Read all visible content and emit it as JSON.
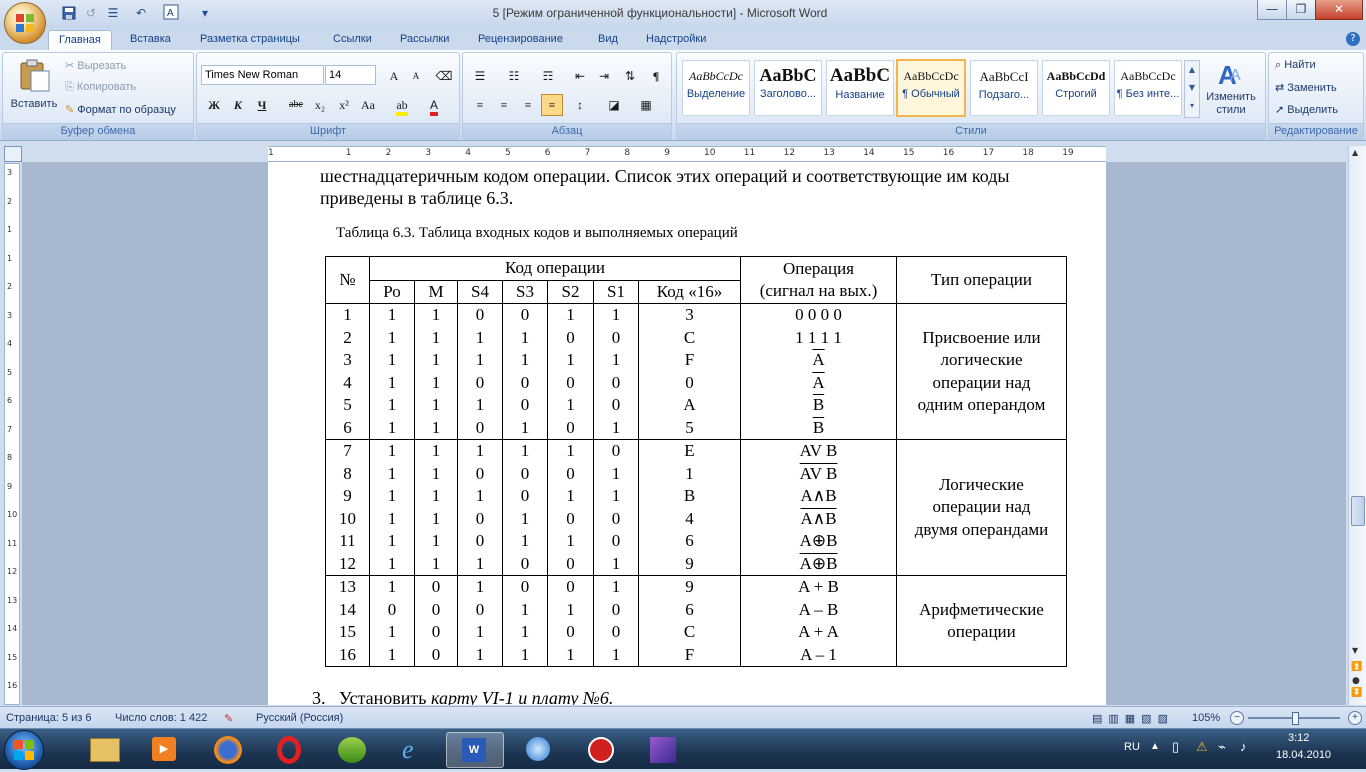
{
  "window": {
    "title": "5 [Режим ограниченной функциональности] - Microsoft Word",
    "controls": [
      "—",
      "❐",
      "✕"
    ]
  },
  "tabs": [
    {
      "label": "Главная",
      "active": true
    },
    {
      "label": "Вставка"
    },
    {
      "label": "Разметка страницы"
    },
    {
      "label": "Ссылки"
    },
    {
      "label": "Рассылки"
    },
    {
      "label": "Рецензирование"
    },
    {
      "label": "Вид"
    },
    {
      "label": "Надстройки"
    }
  ],
  "clipboard": {
    "group_label": "Буфер обмена",
    "paste": "Вставить",
    "cut": "Вырезать",
    "copy": "Копировать",
    "format_painter": "Формат по образцу"
  },
  "font": {
    "group_label": "Шрифт",
    "name": "Times New Roman",
    "size": "14",
    "bold": "Ж",
    "italic": "К",
    "underline": "Ч",
    "strike": "abe",
    "sub": "x₂",
    "sup": "x²",
    "case": "Aa",
    "grow": "A",
    "shrink": "A"
  },
  "paragraph": {
    "group_label": "Абзац"
  },
  "styles": {
    "group_label": "Стили",
    "items": [
      {
        "sample": "AaBbCcDc",
        "name": "Выделение"
      },
      {
        "sample": "AaBbC",
        "name": "Заголово..."
      },
      {
        "sample": "AaBbC",
        "name": "Название"
      },
      {
        "sample": "AaBbCcDc",
        "name": "¶ Обычный",
        "selected": true
      },
      {
        "sample": "AaBbCcI",
        "name": "Подзаго..."
      },
      {
        "sample": "AaBbCcDd",
        "name": "Строгий"
      },
      {
        "sample": "AaBbCcDc",
        "name": "¶ Без инте..."
      }
    ],
    "change_styles": "Изменить стили"
  },
  "editing": {
    "group_label": "Редактирование",
    "find": "Найти",
    "replace": "Заменить",
    "select": "Выделить"
  },
  "ruler": {
    "h_numbers": [
      "1",
      "1",
      "2",
      "3",
      "4",
      "5",
      "6",
      "7",
      "8",
      "9",
      "10",
      "11",
      "12",
      "13",
      "14",
      "15",
      "16",
      "17",
      "18",
      "19"
    ],
    "v_numbers": [
      "3",
      "2",
      "1",
      "1",
      "2",
      "3",
      "4",
      "5",
      "6",
      "7",
      "8",
      "9",
      "10",
      "11",
      "12",
      "13",
      "14",
      "15",
      "16"
    ]
  },
  "document": {
    "para1_line1": "шестнадцатеричным кодом операции. Список этих операций и соответствующие им коды",
    "para1_line2": "приведены в таблице 6.3.",
    "caption": "Таблица 6.3. Таблица входных кодов и выполняемых операций",
    "table": {
      "h_num": "№",
      "h_code": "Код операции",
      "h_op_line1": "Операция",
      "h_op_line2": "(сигнал на вых.)",
      "h_type": "Тип операции",
      "sub": [
        "Ро",
        "М",
        "S4",
        "S3",
        "S2",
        "S1",
        "Код «16»"
      ],
      "rows": [
        [
          "1",
          "1",
          "1",
          "0",
          "0",
          "1",
          "1",
          "3"
        ],
        [
          "2",
          "1",
          "1",
          "1",
          "1",
          "0",
          "0",
          "C"
        ],
        [
          "3",
          "1",
          "1",
          "1",
          "1",
          "1",
          "1",
          "F"
        ],
        [
          "4",
          "1",
          "1",
          "0",
          "0",
          "0",
          "0",
          "0"
        ],
        [
          "5",
          "1",
          "1",
          "1",
          "0",
          "1",
          "0",
          "A"
        ],
        [
          "6",
          "1",
          "1",
          "0",
          "1",
          "0",
          "1",
          "5"
        ],
        [
          "7",
          "1",
          "1",
          "1",
          "1",
          "1",
          "0",
          "E"
        ],
        [
          "8",
          "1",
          "1",
          "0",
          "0",
          "0",
          "1",
          "1"
        ],
        [
          "9",
          "1",
          "1",
          "1",
          "0",
          "1",
          "1",
          "B"
        ],
        [
          "10",
          "1",
          "1",
          "0",
          "1",
          "0",
          "0",
          "4"
        ],
        [
          "11",
          "1",
          "1",
          "0",
          "1",
          "1",
          "0",
          "6"
        ],
        [
          "12",
          "1",
          "1",
          "1",
          "0",
          "0",
          "1",
          "9"
        ],
        [
          "13",
          "1",
          "0",
          "1",
          "0",
          "0",
          "1",
          "9"
        ],
        [
          "14",
          "0",
          "0",
          "0",
          "1",
          "1",
          "0",
          "6"
        ],
        [
          "15",
          "1",
          "0",
          "1",
          "1",
          "0",
          "0",
          "C"
        ],
        [
          "16",
          "1",
          "0",
          "1",
          "1",
          "1",
          "1",
          "F"
        ]
      ],
      "ops": {
        "r1": "0   0  0  0",
        "r2": "1   1  1  1",
        "r3": "A",
        "r4": "A",
        "r5": "B",
        "r6": "B",
        "r7_a": "AV",
        "r7_b": "B",
        "r8_a": "AV",
        "r8_b": "B",
        "r9_a": "A",
        "r9_op": "∧",
        "r9_b": "B",
        "r10_a": "A",
        "r10_op": "∧",
        "r10_b": "B",
        "r11_a": "A",
        "r11_op": "⊕",
        "r11_b": "B",
        "r12_a": "A",
        "r12_op": "⊕",
        "r12_b": "B",
        "r13": "A + B",
        "r14": "A – B",
        "r15": "A + A",
        "r16": "A – 1"
      },
      "types": {
        "g1": [
          "Присвоение или",
          "логические",
          "операции над",
          "одним операндом"
        ],
        "g2": [
          "Логические",
          "операции над",
          "двумя операндами"
        ],
        "g3": [
          "Арифметические",
          "операции"
        ]
      }
    },
    "item3_num": "3.",
    "item3_text_regular": "Установить ",
    "item3_text_italic": "карту VI-1 и плату №6."
  },
  "status": {
    "page": "Страница: 5 из 6",
    "words": "Число слов: 1 422",
    "lang": "Русский (Россия)",
    "zoom": "105%"
  },
  "taskbar": {
    "lang": "RU",
    "time": "3:12",
    "date": "18.04.2010"
  }
}
